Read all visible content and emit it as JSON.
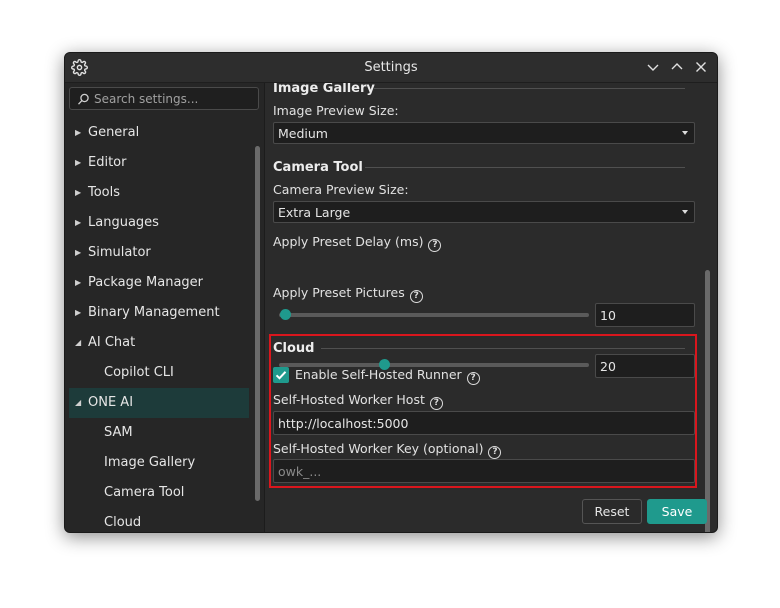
{
  "window": {
    "title": "Settings",
    "app_icon": "gear-icon",
    "controls": [
      "chevron-down-icon",
      "chevron-up-icon",
      "close-icon"
    ]
  },
  "sidebar": {
    "search": {
      "placeholder": "Search settings...",
      "value": ""
    },
    "items": [
      {
        "label": "General",
        "expanded": false
      },
      {
        "label": "Editor",
        "expanded": false
      },
      {
        "label": "Tools",
        "expanded": false
      },
      {
        "label": "Languages",
        "expanded": false
      },
      {
        "label": "Simulator",
        "expanded": false
      },
      {
        "label": "Package Manager",
        "expanded": false
      },
      {
        "label": "Binary Management",
        "expanded": false
      },
      {
        "label": "AI Chat",
        "expanded": true
      },
      {
        "label": "Copilot CLI",
        "child": true
      },
      {
        "label": "ONE AI",
        "expanded": true,
        "selected": true
      },
      {
        "label": "SAM",
        "child": true
      },
      {
        "label": "Image Gallery",
        "child": true
      },
      {
        "label": "Camera Tool",
        "child": true
      },
      {
        "label": "Cloud",
        "child": true
      }
    ]
  },
  "content": {
    "image_gallery": {
      "title": "Image Gallery",
      "preview_label": "Image Preview Size:",
      "preview_value": "Medium"
    },
    "camera_tool": {
      "title": "Camera Tool",
      "preview_label": "Camera Preview Size:",
      "preview_value": "Extra Large",
      "delay_label": "Apply Preset Delay (ms)",
      "delay_value": "10",
      "delay_fraction": 0.02,
      "pictures_label": "Apply Preset Pictures",
      "pictures_value": "20",
      "pictures_fraction": 0.34
    },
    "cloud": {
      "title": "Cloud",
      "enable_label": "Enable Self-Hosted Runner",
      "enable_checked": true,
      "host_label": "Self-Hosted Worker Host",
      "host_value": "http://localhost:5000",
      "key_label": "Self-Hosted Worker Key (optional)",
      "key_placeholder": "owk_..."
    }
  },
  "footer": {
    "reset_label": "Reset",
    "save_label": "Save"
  },
  "colors": {
    "accent": "#1f9a8d",
    "highlight_border": "#d9161d",
    "selected_bg": "#1d3b3a",
    "window_bg": "#2b2b2b"
  }
}
